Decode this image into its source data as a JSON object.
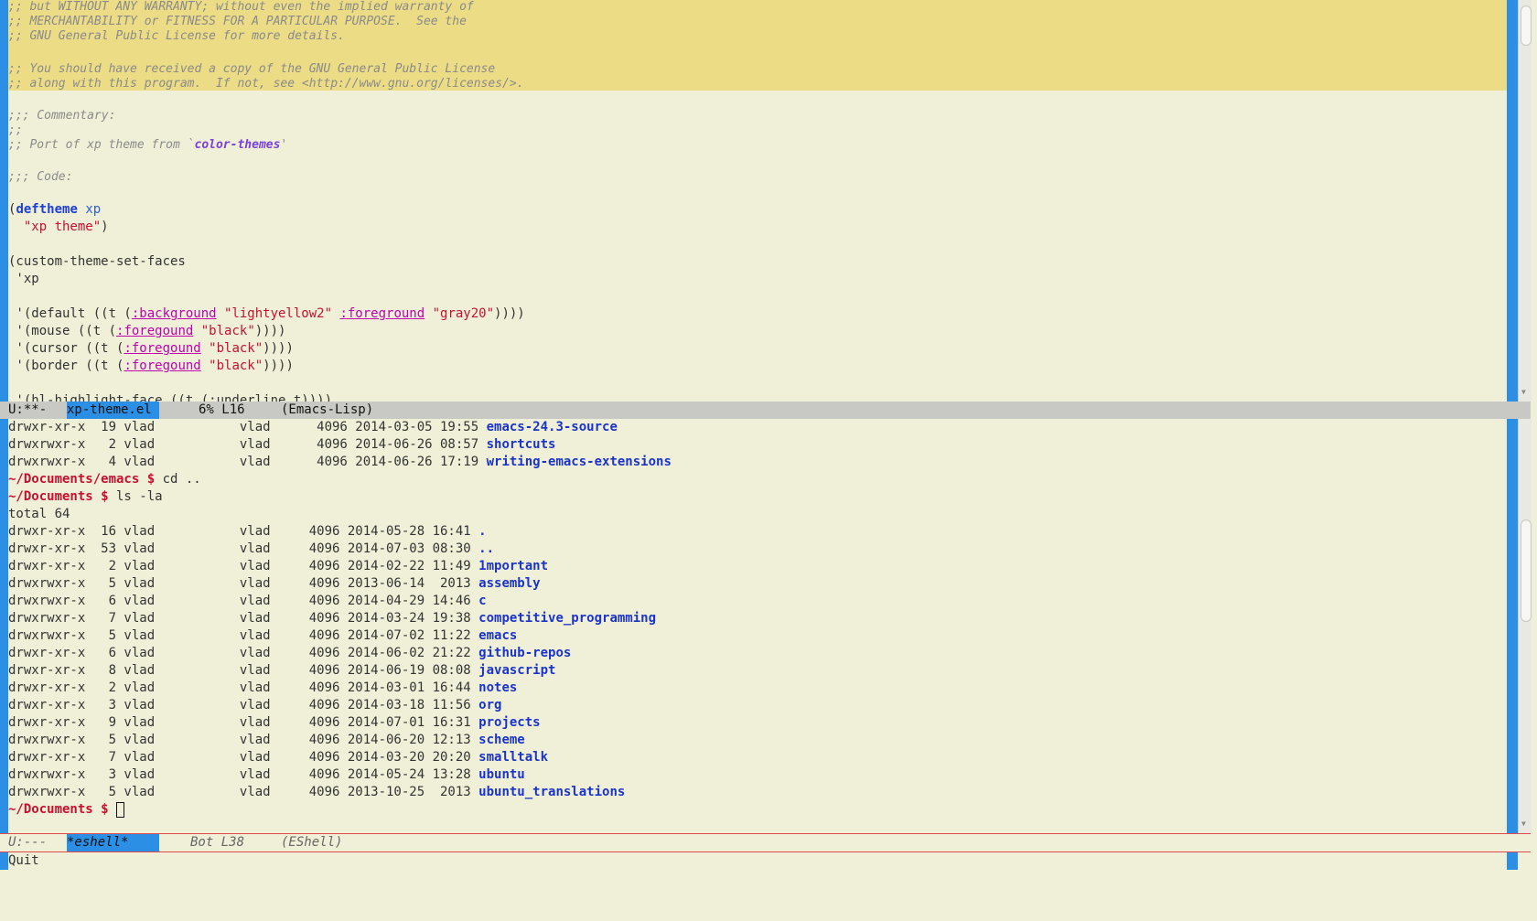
{
  "top_buffer": {
    "header_comments": [
      ";; but WITHOUT ANY WARRANTY; without even the implied warranty of",
      ";; MERCHANTABILITY or FITNESS FOR A PARTICULAR PURPOSE.  See the",
      ";; GNU General Public License for more details.",
      ";; You should have received a copy of the GNU General Public License",
      ";; along with this program.  If not, see <http://www.gnu.org/licenses/>."
    ],
    "commentary": {
      "header": ";;; Commentary:",
      "blank": ";;",
      "port_prefix": ";; Port of xp theme from `",
      "port_link": "color-themes",
      "port_suffix": "'",
      "code_header": ";;; Code:"
    },
    "deftheme": {
      "open": "(",
      "keyword": "deftheme",
      "name": "xp",
      "doc_indent": "  ",
      "doc": "\"xp theme\"",
      "close": ")"
    },
    "faces_call": "(custom-theme-set-faces",
    "faces_arg": " 'xp",
    "faces": [
      {
        "prefix": " '(default ((t (",
        "k1": ":background",
        "v1": " \"lightyellow2\" ",
        "k2": ":foreground",
        "v2": " \"gray20\"",
        "suffix": "))))"
      },
      {
        "prefix": " '(mouse ((t (",
        "k1": ":foregound",
        "v1": " \"black\"",
        "suffix": "))))"
      },
      {
        "prefix": " '(cursor ((t (",
        "k1": ":foregound",
        "v1": " \"black\"",
        "suffix": "))))"
      },
      {
        "prefix": " '(border ((t (",
        "k1": ":foregound",
        "v1": " \"black\"",
        "suffix": "))))"
      }
    ],
    "partial_line": " '(hl-highlight-face ((t (:underline t))))"
  },
  "top_modeline": {
    "status": "U:**-  ",
    "buffer": "xp-theme.el ",
    "position": "6% L16",
    "mode": "(Emacs-Lisp)"
  },
  "shell": {
    "prev_entries": [
      {
        "perm": "drwxr-xr-x  19 vlad           vlad      4096 2014-03-05 19:55 ",
        "name": "emacs-24.3-source"
      },
      {
        "perm": "drwxrwxr-x   2 vlad           vlad      4096 2014-06-26 08:57 ",
        "name": "shortcuts"
      },
      {
        "perm": "drwxrwxr-x   4 vlad           vlad      4096 2014-06-26 17:19 ",
        "name": "writing-emacs-extensions"
      }
    ],
    "cmd1": {
      "prompt": "~/Documents/emacs $",
      "command": " cd .."
    },
    "cmd2": {
      "prompt": "~/Documents $",
      "command": " ls -la"
    },
    "total": "total 64",
    "entries": [
      {
        "perm": "drwxr-xr-x  16 vlad           vlad     4096 2014-05-28 16:41 ",
        "name": "."
      },
      {
        "perm": "drwxr-xr-x  53 vlad           vlad     4096 2014-07-03 08:30 ",
        "name": ".."
      },
      {
        "perm": "drwxr-xr-x   2 vlad           vlad     4096 2014-02-22 11:49 ",
        "name": "1mportant"
      },
      {
        "perm": "drwxrwxr-x   5 vlad           vlad     4096 2013-06-14  2013 ",
        "name": "assembly"
      },
      {
        "perm": "drwxrwxr-x   6 vlad           vlad     4096 2014-04-29 14:46 ",
        "name": "c"
      },
      {
        "perm": "drwxrwxr-x   7 vlad           vlad     4096 2014-03-24 19:38 ",
        "name": "competitive_programming"
      },
      {
        "perm": "drwxrwxr-x   5 vlad           vlad     4096 2014-07-02 11:22 ",
        "name": "emacs"
      },
      {
        "perm": "drwxr-xr-x   6 vlad           vlad     4096 2014-06-02 21:22 ",
        "name": "github-repos"
      },
      {
        "perm": "drwxr-xr-x   8 vlad           vlad     4096 2014-06-19 08:08 ",
        "name": "javascript"
      },
      {
        "perm": "drwxr-xr-x   2 vlad           vlad     4096 2014-03-01 16:44 ",
        "name": "notes"
      },
      {
        "perm": "drwxr-xr-x   3 vlad           vlad     4096 2014-03-18 11:56 ",
        "name": "org"
      },
      {
        "perm": "drwxr-xr-x   9 vlad           vlad     4096 2014-07-01 16:31 ",
        "name": "projects"
      },
      {
        "perm": "drwxrwxr-x   5 vlad           vlad     4096 2014-06-20 12:13 ",
        "name": "scheme"
      },
      {
        "perm": "drwxr-xr-x   7 vlad           vlad     4096 2014-03-20 20:20 ",
        "name": "smalltalk"
      },
      {
        "perm": "drwxrwxr-x   3 vlad           vlad     4096 2014-05-24 13:28 ",
        "name": "ubuntu"
      },
      {
        "perm": "drwxrwxr-x   5 vlad           vlad     4096 2013-10-25  2013 ",
        "name": "ubuntu_translations"
      }
    ],
    "current_prompt": "~/Documents $",
    "colors": {
      "prompt": "#c8102e",
      "directory": "#1a33cc"
    }
  },
  "bottom_modeline": {
    "status": "U:---  ",
    "buffer": "*eshell*    ",
    "position": "Bot L38",
    "mode": "(EShell)"
  },
  "echo_area": "Quit",
  "colors": {
    "fringe": "#2b8fe6",
    "highlight_band": "#ecdc86",
    "background": "#f0f0d8"
  }
}
